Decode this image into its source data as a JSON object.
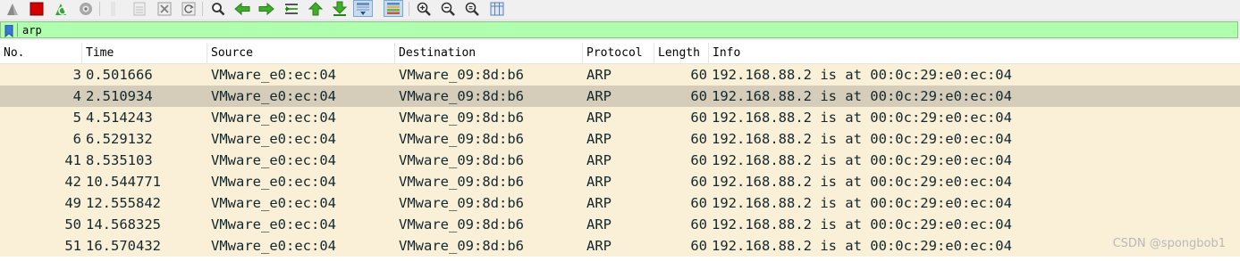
{
  "toolbar": {
    "buttons": [
      {
        "icon": "shark-fin-start-icon"
      },
      {
        "icon": "stop-capture-icon"
      },
      {
        "icon": "restart-capture-icon"
      },
      {
        "icon": "capture-options-icon"
      },
      {
        "icon": "open-file-icon"
      },
      {
        "icon": "save-file-icon"
      },
      {
        "icon": "close-file-icon"
      },
      {
        "icon": "reload-file-icon"
      },
      {
        "icon": "find-packet-icon"
      },
      {
        "icon": "go-back-icon"
      },
      {
        "icon": "go-forward-icon"
      },
      {
        "icon": "go-to-packet-icon"
      },
      {
        "icon": "go-first-icon"
      },
      {
        "icon": "go-last-icon"
      },
      {
        "icon": "auto-scroll-icon"
      },
      {
        "icon": "colorize-icon"
      },
      {
        "icon": "zoom-in-icon"
      },
      {
        "icon": "zoom-out-icon"
      },
      {
        "icon": "normal-size-icon"
      },
      {
        "icon": "resize-columns-icon"
      }
    ]
  },
  "filter": {
    "value": "arp",
    "background": "#afffaf"
  },
  "columns": [
    "No.",
    "Time",
    "Source",
    "Destination",
    "Protocol",
    "Length",
    "Info"
  ],
  "row_colors": {
    "normal": "#faf0d7",
    "selected": "#d5cdb9"
  },
  "packets": [
    {
      "no": "3",
      "time": "0.501666",
      "source": "VMware_e0:ec:04",
      "destination": "VMware_09:8d:b6",
      "protocol": "ARP",
      "length": "60",
      "info": "192.168.88.2 is at 00:0c:29:e0:ec:04",
      "selected": false
    },
    {
      "no": "4",
      "time": "2.510934",
      "source": "VMware_e0:ec:04",
      "destination": "VMware_09:8d:b6",
      "protocol": "ARP",
      "length": "60",
      "info": "192.168.88.2 is at 00:0c:29:e0:ec:04",
      "selected": true
    },
    {
      "no": "5",
      "time": "4.514243",
      "source": "VMware_e0:ec:04",
      "destination": "VMware_09:8d:b6",
      "protocol": "ARP",
      "length": "60",
      "info": "192.168.88.2 is at 00:0c:29:e0:ec:04",
      "selected": false
    },
    {
      "no": "6",
      "time": "6.529132",
      "source": "VMware_e0:ec:04",
      "destination": "VMware_09:8d:b6",
      "protocol": "ARP",
      "length": "60",
      "info": "192.168.88.2 is at 00:0c:29:e0:ec:04",
      "selected": false
    },
    {
      "no": "41",
      "time": "8.535103",
      "source": "VMware_e0:ec:04",
      "destination": "VMware_09:8d:b6",
      "protocol": "ARP",
      "length": "60",
      "info": "192.168.88.2 is at 00:0c:29:e0:ec:04",
      "selected": false
    },
    {
      "no": "42",
      "time": "10.544771",
      "source": "VMware_e0:ec:04",
      "destination": "VMware_09:8d:b6",
      "protocol": "ARP",
      "length": "60",
      "info": "192.168.88.2 is at 00:0c:29:e0:ec:04",
      "selected": false
    },
    {
      "no": "49",
      "time": "12.555842",
      "source": "VMware_e0:ec:04",
      "destination": "VMware_09:8d:b6",
      "protocol": "ARP",
      "length": "60",
      "info": "192.168.88.2 is at 00:0c:29:e0:ec:04",
      "selected": false
    },
    {
      "no": "50",
      "time": "14.568325",
      "source": "VMware_e0:ec:04",
      "destination": "VMware_09:8d:b6",
      "protocol": "ARP",
      "length": "60",
      "info": "192.168.88.2 is at 00:0c:29:e0:ec:04",
      "selected": false
    },
    {
      "no": "51",
      "time": "16.570432",
      "source": "VMware_e0:ec:04",
      "destination": "VMware_09:8d:b6",
      "protocol": "ARP",
      "length": "60",
      "info": "192.168.88.2 is at 00:0c:29:e0:ec:04",
      "selected": false
    }
  ],
  "watermark": "CSDN @spongbob1"
}
